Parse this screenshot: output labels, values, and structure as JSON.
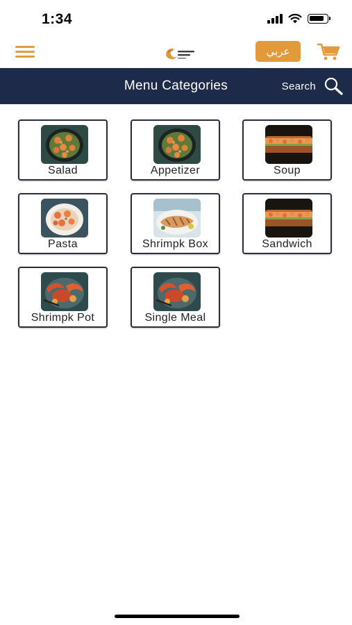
{
  "status_bar": {
    "time": "1:34"
  },
  "header": {
    "lang_button_label": "عربي",
    "icons": {
      "menu": "hamburger-menu-icon",
      "cart": "cart-icon",
      "logo": "shrimp-logo"
    },
    "accent_color": "#e39a3a"
  },
  "nav": {
    "title": "Menu Categories",
    "search_label": "Search",
    "background_color": "#1e2a49"
  },
  "categories": [
    {
      "label": "Salad",
      "image": "shrimp-bowl"
    },
    {
      "label": "Appetizer",
      "image": "shrimp-bowl"
    },
    {
      "label": "Soup",
      "image": "sandwich"
    },
    {
      "label": "Pasta",
      "image": "shrimp-plate"
    },
    {
      "label": "Shrimpk Box",
      "image": "grilled-fish"
    },
    {
      "label": "Sandwich",
      "image": "sandwich"
    },
    {
      "label": "Shrimpk Pot",
      "image": "seafood-pot"
    },
    {
      "label": "Single Meal",
      "image": "seafood-pot"
    }
  ]
}
